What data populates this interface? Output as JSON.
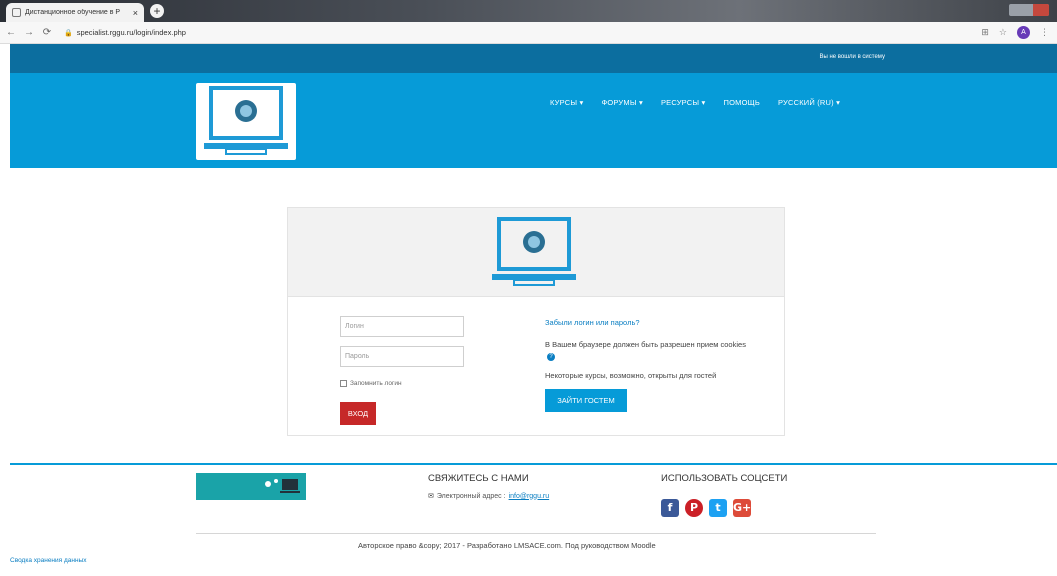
{
  "browser": {
    "tab_title": "Дистанционное обучение в Р",
    "tab_close": "×",
    "new_tab": "+",
    "url": "specialist.rggu.ru/login/index.php",
    "profile_initial": "A"
  },
  "topbar": {
    "login_status": "Вы не вошли в систему"
  },
  "nav": {
    "items": [
      {
        "label": "КУРСЫ ▾"
      },
      {
        "label": "ФОРУМЫ ▾"
      },
      {
        "label": "РЕСУРСЫ ▾"
      },
      {
        "label": "ПОМОЩЬ"
      },
      {
        "label": "РУССКИЙ (RU) ▾"
      }
    ]
  },
  "login": {
    "username_placeholder": "Логин",
    "password_placeholder": "Пароль",
    "remember_label": "Запомнить логин",
    "login_button": "ВХОД",
    "forgot_link": "Забыли логин или пароль?",
    "cookies_text": "В Вашем браузере должен быть разрешен прием cookies",
    "help_glyph": "?",
    "guests_text": "Некоторые курсы, возможно, открыты для гостей",
    "guest_button": "ЗАЙТИ ГОСТЕМ"
  },
  "footer": {
    "contact_title": "СВЯЖИТЕСЬ С НАМИ",
    "email_label": "Электронный адрес :",
    "email_value": "info@rggu.ru",
    "social_title": "ИСПОЛЬЗОВАТЬ СОЦСЕТИ",
    "social_icons": {
      "facebook": "f",
      "pinterest": "P",
      "twitter": "t",
      "googleplus": "G+"
    },
    "copyright": "Авторское право &copy; 2017 - Разработано LMSACE.com. Под руководством Moodle",
    "data_retention": "Сводка хранения данных"
  },
  "colors": {
    "topbar": "#0c6e9f",
    "navbar": "#069bd8",
    "login_button": "#c62828",
    "guest_button": "#069bd8",
    "link": "#0a7ec2"
  }
}
